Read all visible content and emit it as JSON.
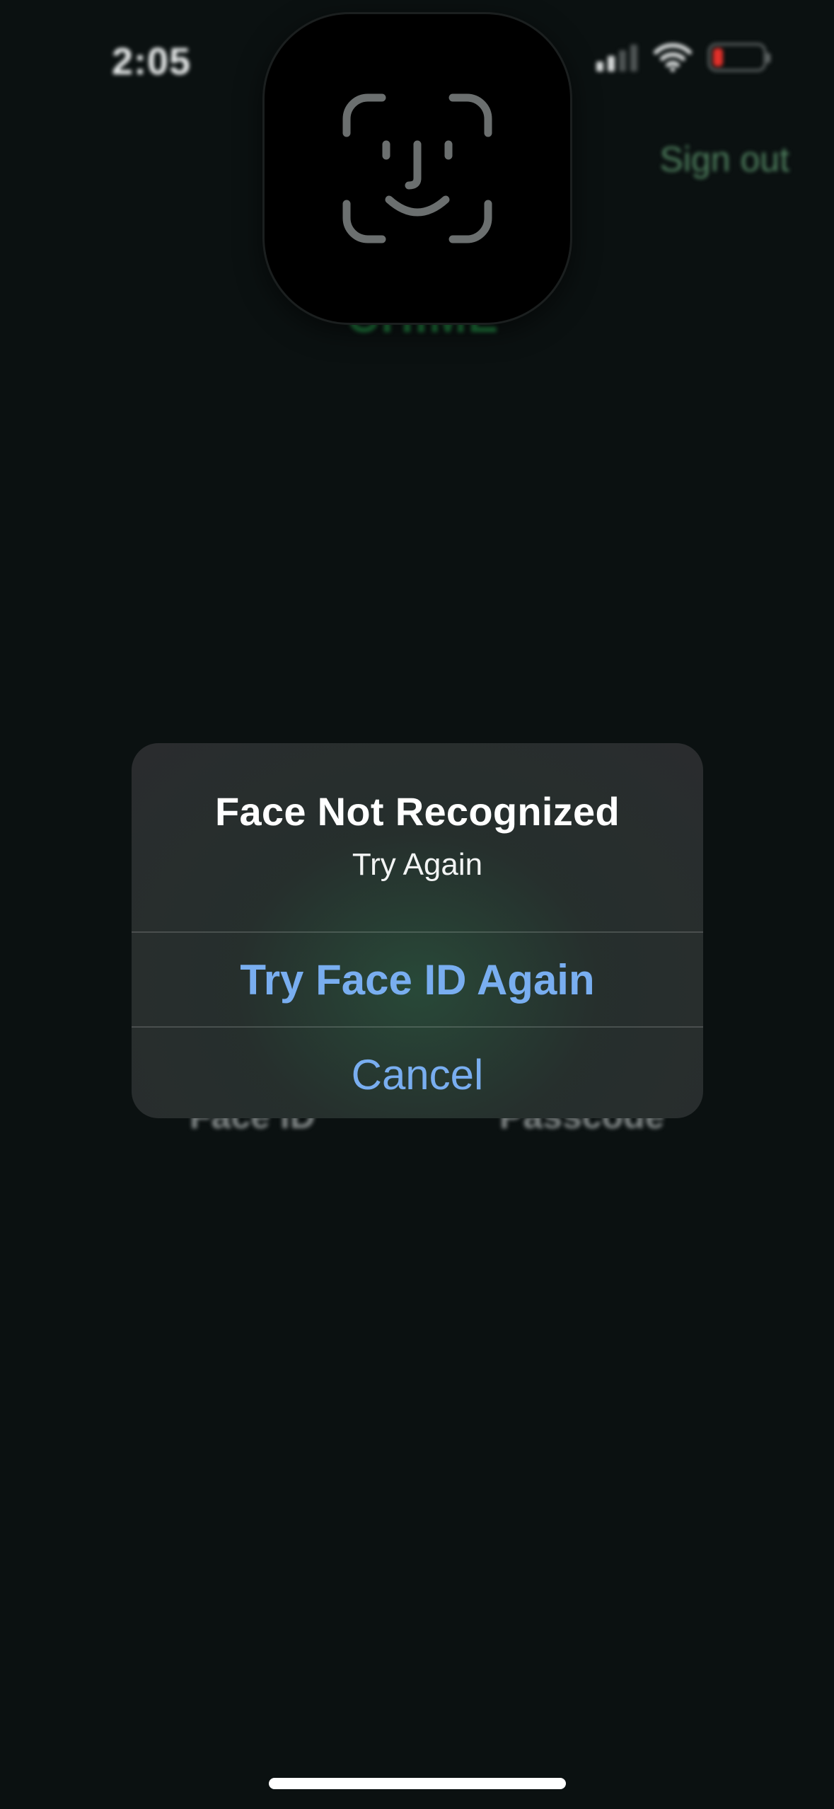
{
  "status_bar": {
    "time": "2:05",
    "battery_color": "#e0302a"
  },
  "background_app": {
    "sign_out_label": "Sign out",
    "brand_name": "CHIME",
    "option_face_id": "Face ID",
    "option_passcode": "Passcode"
  },
  "alert": {
    "title": "Face Not Recognized",
    "message": "Try Again",
    "primary_button": "Try Face ID Again",
    "cancel_button": "Cancel",
    "button_color": "#79aef0"
  },
  "icons": {
    "faceid": "face-id-icon",
    "signal": "cellular-signal-icon",
    "wifi": "wifi-icon",
    "battery": "battery-icon"
  }
}
